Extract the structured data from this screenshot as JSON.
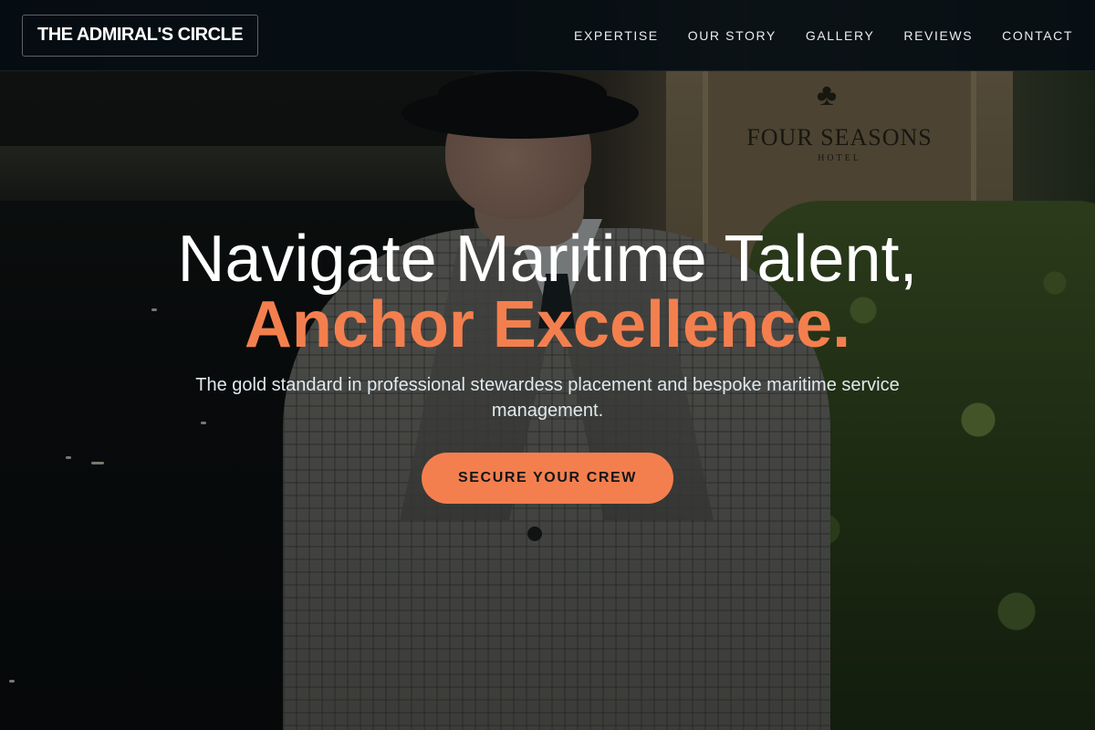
{
  "header": {
    "brand": "THE ADMIRAL'S CIRCLE",
    "nav": [
      {
        "label": "EXPERTISE"
      },
      {
        "label": "OUR STORY"
      },
      {
        "label": "GALLERY"
      },
      {
        "label": "REVIEWS"
      },
      {
        "label": "CONTACT"
      }
    ]
  },
  "hero": {
    "title_line1": "Navigate Maritime Talent,",
    "title_line2": "Anchor Excellence.",
    "subtitle": "The gold standard in professional stewardess placement and bespoke maritime service management.",
    "cta_label": "SECURE YOUR CREW"
  },
  "background": {
    "sign_text": "FOUR SEASONS",
    "sign_subtext": "HOTEL"
  },
  "colors": {
    "accent": "#f47f4e",
    "header_bg": "#060e14",
    "text_light": "#ffffff"
  }
}
